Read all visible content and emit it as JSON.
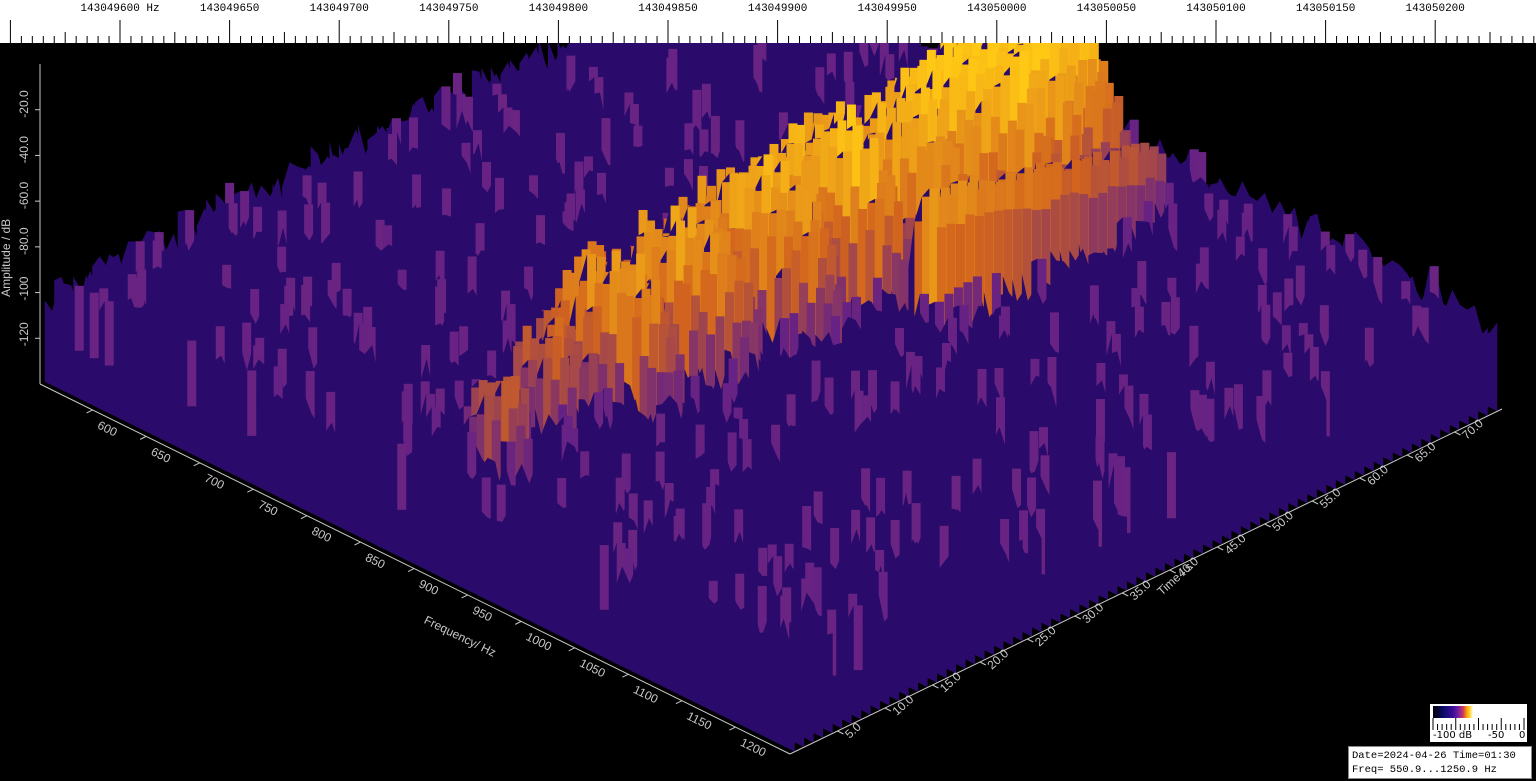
{
  "window": {
    "date_text": "Date=2024-04-26 Time=01:30",
    "freq_text": "Freq= 550.9...1250.9 Hz"
  },
  "colors": {
    "background": "#000000",
    "floor_low": "#2a0a6a",
    "floor_mid": "#5a1a90",
    "peak_mid": "#d2641e",
    "peak_high": "#ffc814"
  },
  "legend": {
    "label_min": "-100 dB",
    "label_mid": "-50",
    "label_max": "0"
  },
  "chart_data": {
    "type": "area",
    "subtype": "3d waterfall spectrum",
    "top_scale": {
      "ticks": [
        "143049600 Hz",
        "143049650",
        "143049700",
        "143049750",
        "143049800",
        "143049850",
        "143049900",
        "143049950",
        "143050000",
        "143050050",
        "143050100",
        "143050150",
        "143050200"
      ]
    },
    "frequency_axis": {
      "label": "Frequency/ Hz",
      "range": [
        550.9,
        1250.9
      ],
      "ticks": [
        "600",
        "650",
        "700",
        "750",
        "800",
        "850",
        "900",
        "950",
        "1000",
        "1050",
        "1100",
        "1150",
        "1200"
      ]
    },
    "time_axis": {
      "label": "Time / s",
      "range": [
        0,
        75
      ],
      "ticks": [
        "5.0",
        "10.0",
        "15.0",
        "20.0",
        "25.0",
        "30.0",
        "35.0",
        "40.0",
        "45.0",
        "50.0",
        "55.0",
        "60.0",
        "65.0",
        "70.0"
      ]
    },
    "amplitude_axis": {
      "label": "Amplitude / dB",
      "range": [
        -140,
        0
      ],
      "ticks": [
        "-20.0",
        "-40.0",
        "-60.0",
        "-80.0",
        "-100",
        "-120"
      ]
    },
    "noise_floor_db": -100,
    "signals": [
      {
        "time_s": 8.0,
        "freq_hz": 905,
        "amp_db": -75
      },
      {
        "time_s": 15.0,
        "freq_hz": 890,
        "amp_db": -70
      },
      {
        "time_s": 18.0,
        "freq_hz": 880,
        "amp_db": -68
      },
      {
        "time_s": 21.0,
        "freq_hz": 875,
        "amp_db": -55
      },
      {
        "time_s": 22.0,
        "freq_hz": 900,
        "amp_db": -50
      },
      {
        "time_s": 25.0,
        "freq_hz": 860,
        "amp_db": -60
      },
      {
        "time_s": 28.0,
        "freq_hz": 885,
        "amp_db": -45
      },
      {
        "time_s": 30.0,
        "freq_hz": 900,
        "amp_db": -48
      },
      {
        "time_s": 34.0,
        "freq_hz": 870,
        "amp_db": -50
      },
      {
        "time_s": 37.0,
        "freq_hz": 885,
        "amp_db": -40
      },
      {
        "time_s": 38.0,
        "freq_hz": 905,
        "amp_db": -45
      },
      {
        "time_s": 42.0,
        "freq_hz": 880,
        "amp_db": -40
      },
      {
        "time_s": 45.0,
        "freq_hz": 900,
        "amp_db": -35
      },
      {
        "time_s": 47.0,
        "freq_hz": 870,
        "amp_db": -45
      },
      {
        "time_s": 50.0,
        "freq_hz": 890,
        "amp_db": -42
      },
      {
        "time_s": 52.0,
        "freq_hz": 905,
        "amp_db": -38
      },
      {
        "time_s": 55.0,
        "freq_hz": 885,
        "amp_db": -32
      },
      {
        "time_s": 57.0,
        "freq_hz": 900,
        "amp_db": -30
      },
      {
        "time_s": 59.0,
        "freq_hz": 880,
        "amp_db": -35
      },
      {
        "time_s": 60.0,
        "freq_hz": 910,
        "amp_db": -28
      },
      {
        "time_s": 62.0,
        "freq_hz": 895,
        "amp_db": -30
      },
      {
        "time_s": 64.0,
        "freq_hz": 905,
        "amp_db": -28
      },
      {
        "time_s": 66.0,
        "freq_hz": 890,
        "amp_db": -30
      },
      {
        "time_s": 68.0,
        "freq_hz": 900,
        "amp_db": -32
      }
    ],
    "tail_signal": {
      "time_s": [
        45.0,
        70.0
      ],
      "freq_hz": 975,
      "amp_db": -50
    }
  }
}
